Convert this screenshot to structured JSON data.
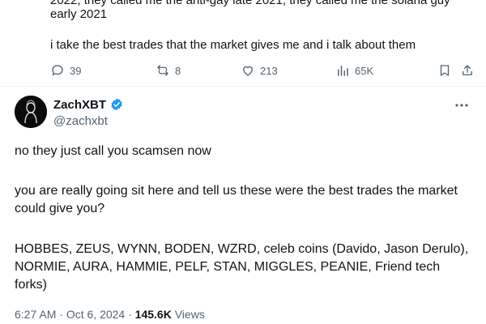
{
  "previous_tweet": {
    "cut_text": "2022, they called me the anti-gay late 2021, they called me the solana guy",
    "line_1": "early 2021",
    "line_2": "i take the best trades that the market gives me and i talk about them",
    "actions": {
      "replies": "39",
      "reposts": "8",
      "likes": "213",
      "views": "65K"
    }
  },
  "tweet": {
    "author": {
      "display_name": "ZachXBT",
      "handle": "@zachxbt"
    },
    "paragraphs": [
      "no they just call you scamsen now",
      "you are really going sit here and tell us these were the best trades the market could give you?",
      "HOBBES, ZEUS, WYNN, BODEN, WZRD, celeb coins (Davido, Jason Derulo), NORMIE, AURA, HAMMIE, PELF, STAN, MIGGLES, PEANIE, Friend tech forks)"
    ],
    "meta": {
      "time": "6:27 AM",
      "sep1": " · ",
      "date": "Oct 6, 2024",
      "sep2": " · ",
      "views_count": "145.6K",
      "views_label": "Views"
    }
  },
  "colors": {
    "text": "#0f1419",
    "secondary": "#536471",
    "verified": "#1d9bf0",
    "divider": "#eff3f4"
  }
}
